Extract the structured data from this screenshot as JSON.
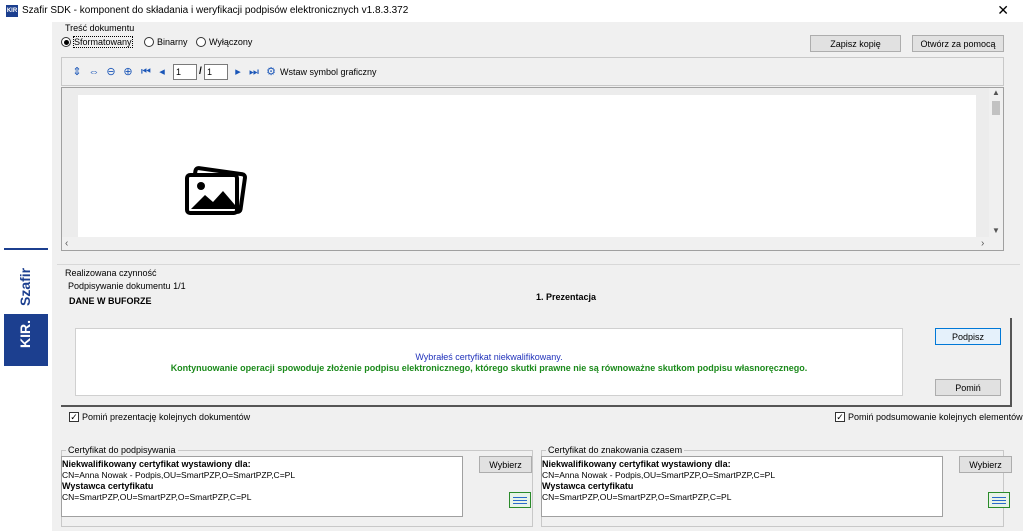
{
  "window": {
    "title": "Szafir SDK - komponent do składania i weryfikacji podpisów elektronicznych v1.8.3.372",
    "app_icon_text": "KIR",
    "close_glyph": "✕"
  },
  "branding": {
    "szafir": "Szafir",
    "kir": "KIR."
  },
  "document_content": {
    "group_label": "Treść dokumentu",
    "radios": [
      {
        "label": "Sformatowany",
        "checked": true
      },
      {
        "label": "Binarny",
        "checked": false
      },
      {
        "label": "Wyłączony",
        "checked": false
      }
    ],
    "save_copy_button": "Zapisz kopię",
    "open_with_button": "Otwórz za pomocą"
  },
  "toolbar": {
    "current_page": "1",
    "page_separator": "/",
    "total_pages": "1",
    "insert_graphic_label": "Wstaw symbol graficzny"
  },
  "activity": {
    "group_label": "Realizowana czynność",
    "signing_progress": "Podpisywanie dokumentu 1/1",
    "buffer_label": "DANE W BUFORZE",
    "step_label": "1. Prezentacja",
    "message_line1": "Wybrałeś certyfikat niekwalifikowany.",
    "message_line2": "Kontynuowanie operacji spowoduje złożenie podpisu elektronicznego, którego skutki prawne nie są równoważne skutkom podpisu własnoręcznego.",
    "sign_button": "Podpisz",
    "skip_button": "Pomiń",
    "skip_presentation_label": "Pomiń prezentację kolejnych dokumentów",
    "skip_presentation_checked": true,
    "skip_summary_label": "Pomiń podsumowanie kolejnych elementów",
    "skip_summary_checked": true
  },
  "signing_certificate": {
    "group_label": "Certyfikat do podpisywania",
    "issued_for_heading": "Niekwalifikowany certyfikat wystawiony dla:",
    "subject": "CN=Anna Nowak - Podpis,OU=SmartPZP,O=SmartPZP,C=PL",
    "issuer_heading": "Wystawca certyfikatu",
    "issuer": "CN=SmartPZP,OU=SmartPZP,O=SmartPZP,C=PL",
    "choose_button": "Wybierz"
  },
  "timestamp_certificate": {
    "group_label": "Certyfikat do znakowania czasem",
    "issued_for_heading": "Niekwalifikowany certyfikat wystawiony dla:",
    "subject": "CN=Anna Nowak - Podpis,OU=SmartPZP,O=SmartPZP,C=PL",
    "issuer_heading": "Wystawca certyfikatu",
    "issuer": "CN=SmartPZP,OU=SmartPZP,O=SmartPZP,C=PL",
    "choose_button": "Wybierz"
  },
  "colors": {
    "brand_blue": "#1c3f8f",
    "warning_blue": "#2233bb",
    "warning_green": "#1b8a1b"
  }
}
